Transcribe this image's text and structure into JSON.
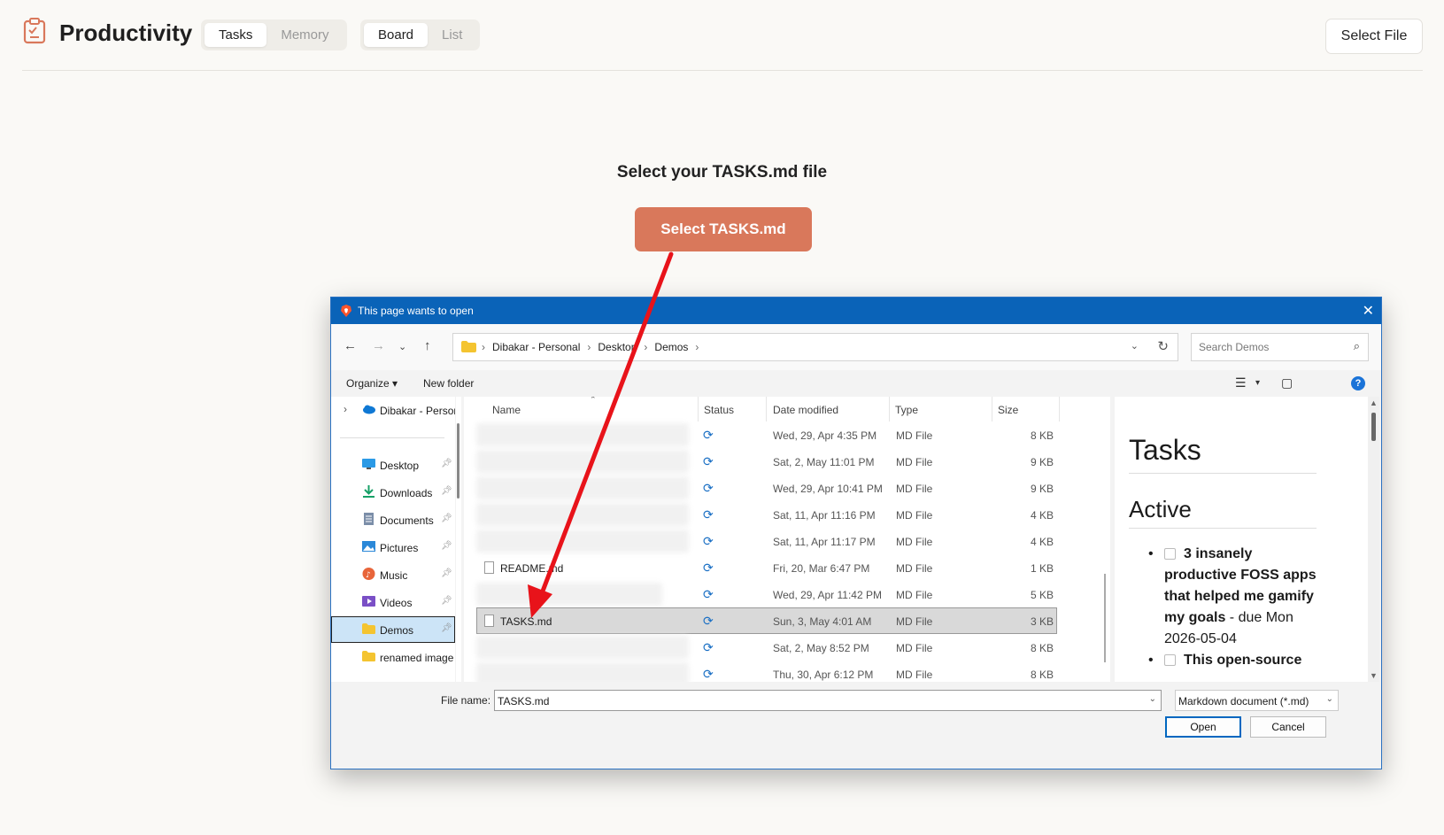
{
  "app": {
    "title": "Productivity",
    "section_tabs": [
      "Tasks",
      "Memory"
    ],
    "active_section_tab": "Tasks",
    "view_tabs": [
      "Board",
      "List"
    ],
    "active_view_tab": "Board",
    "select_file_label": "Select File",
    "accent_color": "#d9785b"
  },
  "main": {
    "prompt_title": "Select your TASKS.md file",
    "primary_button": "Select TASKS.md"
  },
  "dialog": {
    "title": "This page wants to open",
    "breadcrumb": [
      "Dibakar - Personal",
      "Desktop",
      "Demos"
    ],
    "search_placeholder": "Search Demos",
    "toolbar": {
      "organize": "Organize",
      "new_folder": "New folder"
    },
    "nav_items": [
      {
        "label": "Dibakar - Personal",
        "icon": "onedrive-cloud-icon",
        "pinned": false
      },
      {
        "label": "Desktop",
        "icon": "desktop-icon",
        "pinned": true
      },
      {
        "label": "Downloads",
        "icon": "download-icon",
        "pinned": true
      },
      {
        "label": "Documents",
        "icon": "documents-icon",
        "pinned": true
      },
      {
        "label": "Pictures",
        "icon": "pictures-icon",
        "pinned": true
      },
      {
        "label": "Music",
        "icon": "music-icon",
        "pinned": true
      },
      {
        "label": "Videos",
        "icon": "videos-icon",
        "pinned": true
      },
      {
        "label": "Demos",
        "icon": "folder-icon",
        "pinned": true,
        "selected": true
      },
      {
        "label": "renamed image",
        "icon": "folder-icon",
        "pinned": false
      }
    ],
    "columns": [
      "Name",
      "Status",
      "Date modified",
      "Type",
      "Size"
    ],
    "files": [
      {
        "name": "",
        "blurred": true,
        "date": "Wed, 29, Apr 4:35 PM",
        "type": "MD File",
        "size": "8 KB"
      },
      {
        "name": "",
        "blurred": true,
        "date": "Sat, 2, May 11:01 PM",
        "type": "MD File",
        "size": "9 KB"
      },
      {
        "name": "",
        "blurred": true,
        "date": "Wed, 29, Apr 10:41 PM",
        "type": "MD File",
        "size": "9 KB"
      },
      {
        "name": "",
        "blurred": true,
        "date": "Sat, 11, Apr 11:16 PM",
        "type": "MD File",
        "size": "4 KB"
      },
      {
        "name": "",
        "blurred": true,
        "date": "Sat, 11, Apr 11:17 PM",
        "type": "MD File",
        "size": "4 KB"
      },
      {
        "name": "README.md",
        "blurred": false,
        "date": "Fri, 20, Mar 6:47 PM",
        "type": "MD File",
        "size": "1 KB"
      },
      {
        "name": "",
        "blurred": true,
        "date": "Wed, 29, Apr 11:42 PM",
        "type": "MD File",
        "size": "5 KB"
      },
      {
        "name": "TASKS.md",
        "blurred": false,
        "selected": true,
        "date": "Sun, 3, May 4:01 AM",
        "type": "MD File",
        "size": "3 KB"
      },
      {
        "name": "",
        "blurred": true,
        "date": "Sat, 2, May 8:52 PM",
        "type": "MD File",
        "size": "8 KB"
      },
      {
        "name": "",
        "blurred": true,
        "date": "Thu, 30, Apr 6:12 PM",
        "type": "MD File",
        "size": "8 KB"
      }
    ],
    "preview": {
      "heading": "Tasks",
      "subheading": "Active",
      "items": [
        {
          "bold": "3 insanely productive FOSS apps that helped me gamify my goals",
          "rest": " - due Mon 2026-05-04"
        },
        {
          "bold": "This open-source",
          "rest": ""
        }
      ]
    },
    "file_name_label": "File name:",
    "file_name_value": "TASKS.md",
    "file_type": "Markdown document (*.md)",
    "open_label": "Open",
    "cancel_label": "Cancel"
  },
  "annotation": {
    "arrow_color": "#e8131a"
  }
}
